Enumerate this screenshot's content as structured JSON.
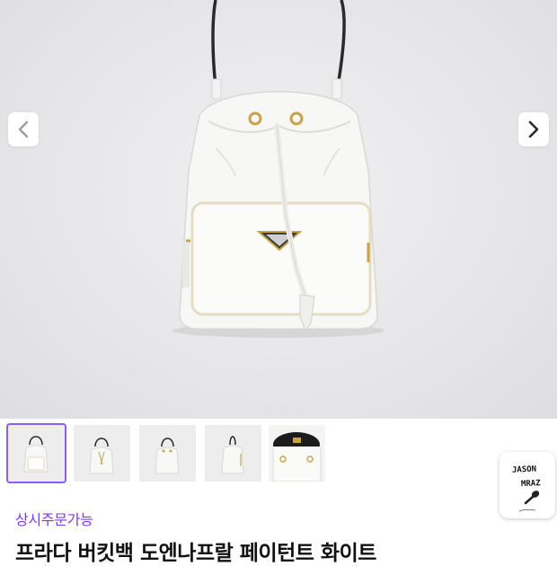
{
  "gallery": {
    "prev_icon": "chevron-left-icon",
    "next_icon": "chevron-right-icon"
  },
  "thumbnails": [
    {
      "name": "thumb-front-view",
      "active": true
    },
    {
      "name": "thumb-strap-view",
      "active": false
    },
    {
      "name": "thumb-back-view",
      "active": false
    },
    {
      "name": "thumb-side-view",
      "active": false
    },
    {
      "name": "thumb-interior-view",
      "active": false
    }
  ],
  "artist_badge": {
    "line1": "JASON",
    "line2": "MRAZ"
  },
  "product": {
    "order_status": "상시주문가능",
    "title": "프라다 버킷백 도엔나프랄 페이턴트 화이트"
  },
  "colors": {
    "accent": "#7c3aed",
    "thumb_border": "#8b5cf6",
    "title": "#111111"
  }
}
